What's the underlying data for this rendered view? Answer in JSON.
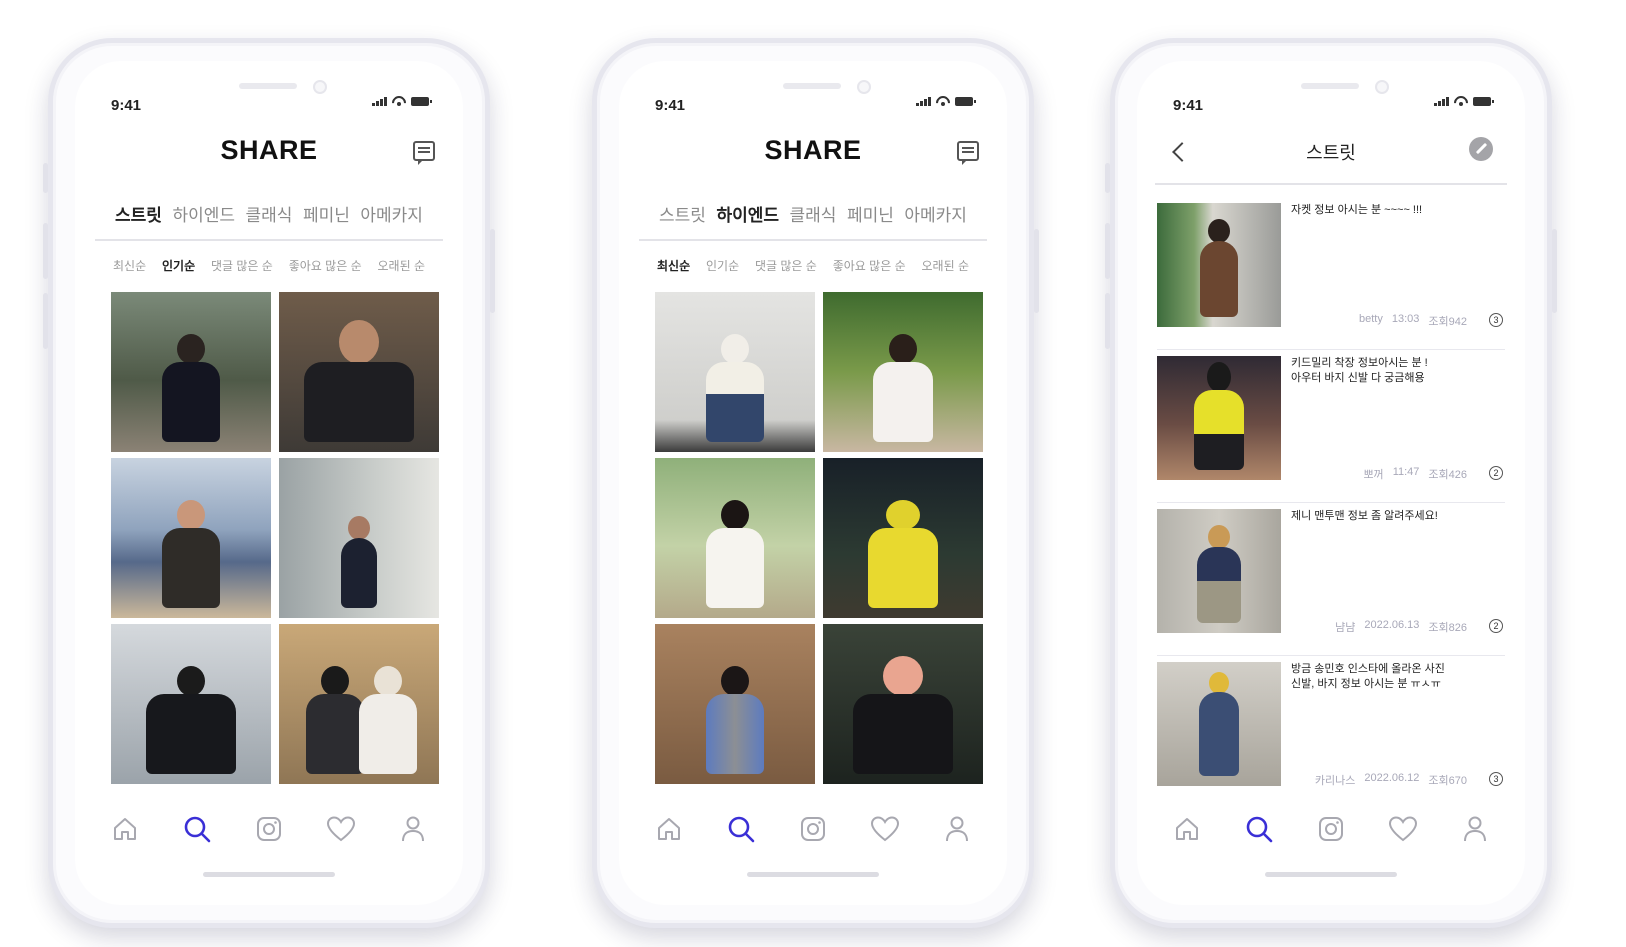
{
  "colors": {
    "accent": "#3a2fd6",
    "icon_gray": "#a8a8b0",
    "text_dark": "#222222",
    "text_gray": "#8a8a8a"
  },
  "status_bar": {
    "time": "9:41"
  },
  "screen1": {
    "brand": "SHARE",
    "categories": [
      "스트릿",
      "하이엔드",
      "클래식",
      "페미닌",
      "아메카지"
    ],
    "active_category": 0,
    "sorts": [
      "최신순",
      "인기순",
      "댓글 많은 순",
      "좋아요 많은 순",
      "오래된 순"
    ],
    "active_sort": 1
  },
  "screen2": {
    "brand": "SHARE",
    "categories": [
      "스트릿",
      "하이엔드",
      "클래식",
      "페미닌",
      "아메카지"
    ],
    "active_category": 1,
    "sorts": [
      "최신순",
      "인기순",
      "댓글 많은 순",
      "좋아요 많은 순",
      "오래된 순"
    ],
    "active_sort": 0
  },
  "screen3": {
    "title": "스트릿",
    "posts": [
      {
        "title": "자켓 정보 아시는 분 ~~~~ !!!",
        "author": "betty",
        "time": "13:03",
        "views": "조회942",
        "comments": "3"
      },
      {
        "title": "키드밀리 착장 정보아시는 분 !\n아우터 바지 신발 다 궁금해용",
        "author": "뽀꺼",
        "time": "11:47",
        "views": "조회426",
        "comments": "2"
      },
      {
        "title": "제니 맨투맨 정보 좀 알려주세요!",
        "author": "냠냠",
        "time": "2022.06.13",
        "views": "조회826",
        "comments": "2"
      },
      {
        "title": "방금 송민호 인스타에 올라온 사진\n신발, 바지 정보 아시는 분 ㅠㅅㅠ",
        "author": "카리나스",
        "time": "2022.06.12",
        "views": "조회670",
        "comments": "3"
      }
    ]
  },
  "nav": [
    "home-icon",
    "search-icon",
    "instagram-icon",
    "heart-icon",
    "profile-icon"
  ],
  "active_nav": 1
}
